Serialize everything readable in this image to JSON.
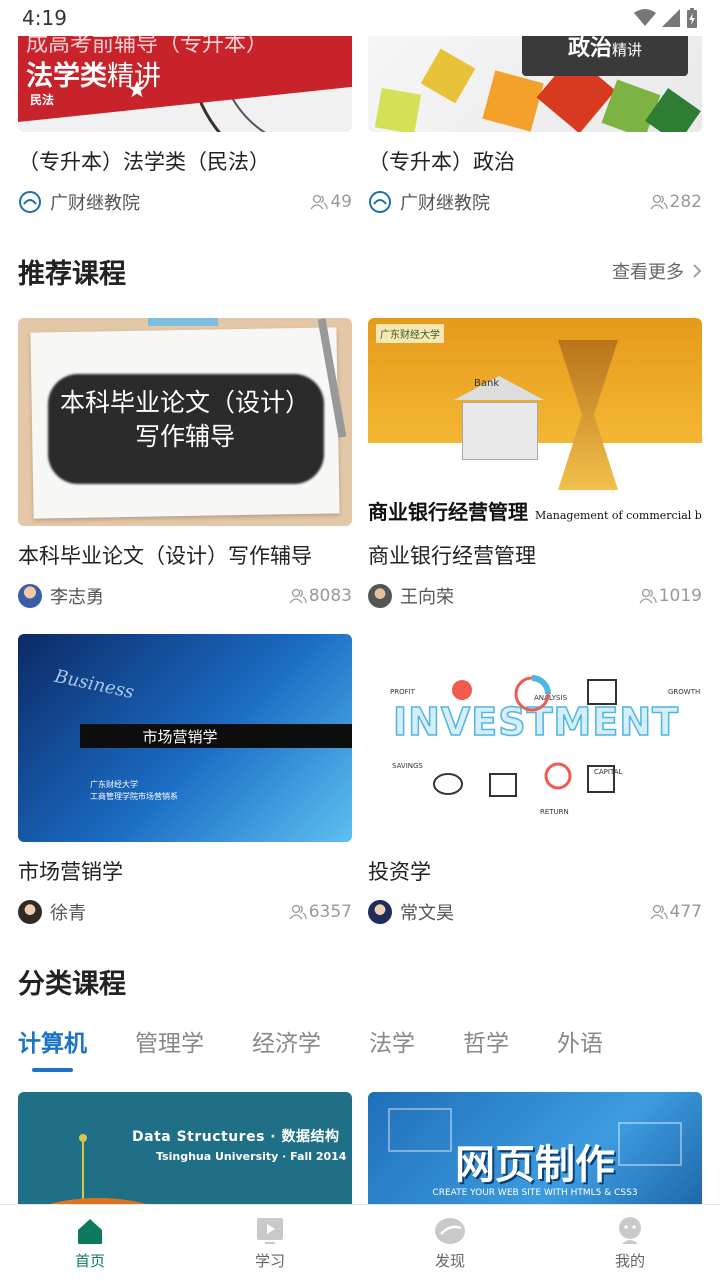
{
  "status": {
    "time": "4:19"
  },
  "top_courses": [
    {
      "banner_line1": "成高考前辅导（专升本）",
      "banner_line2": "法学类",
      "banner_line2b": "精讲",
      "banner_tag": "民法",
      "title": "（专升本）法学类（民法）",
      "author": "广财继教院",
      "count": "49"
    },
    {
      "banner_big": "政治",
      "banner_small": "精讲",
      "title": "（专升本）政治",
      "author": "广财继教院",
      "count": "282"
    }
  ],
  "recommended": {
    "heading": "推荐课程",
    "more": "查看更多",
    "courses": [
      {
        "banner_l1": "本科毕业论文（设计）",
        "banner_l2": "写作辅导",
        "title": "本科毕业论文（设计）写作辅导",
        "author": "李志勇",
        "count": "8083"
      },
      {
        "banner_school": "广东财经大学",
        "banner_bank": "Bank",
        "banner_main": "商业银行经营管理",
        "banner_en": "Management of commercial bar",
        "title": "商业银行经营管理",
        "author": "王向荣",
        "count": "1019"
      },
      {
        "banner_word": "Business",
        "banner_main": "市场营销学",
        "banner_sub1": "广东财经大学",
        "banner_sub2": "工商管理学院市场营销系",
        "title": "市场营销学",
        "author": "徐青",
        "count": "6357"
      },
      {
        "banner_word": "INVESTMENT",
        "banner_labels": [
          "PROFIT",
          "ANALYSIS",
          "GROWTH",
          "SAVINGS",
          "CAPITAL",
          "RETURN"
        ],
        "title": "投资学",
        "author": "常文昊",
        "count": "477"
      }
    ]
  },
  "categories": {
    "heading": "分类课程",
    "tabs": [
      "计算机",
      "管理学",
      "经济学",
      "法学",
      "哲学",
      "外语"
    ],
    "active_tab": "计算机",
    "cards": [
      {
        "banner_title": "Data Structures · 数据结构",
        "banner_sub": "Tsinghua University · Fall 2014"
      },
      {
        "banner_title": "网页制作",
        "banner_sub": "CREATE YOUR WEB SITE WITH HTML5 & CSS3"
      }
    ]
  },
  "bottom_nav": [
    {
      "label": "首页",
      "icon": "home-icon",
      "active": true
    },
    {
      "label": "学习",
      "icon": "play-icon",
      "active": false
    },
    {
      "label": "发现",
      "icon": "discover-icon",
      "active": false
    },
    {
      "label": "我的",
      "icon": "profile-icon",
      "active": false
    }
  ],
  "colors": {
    "accent": "#1a73c8",
    "nav_active": "#0b7a5e"
  }
}
